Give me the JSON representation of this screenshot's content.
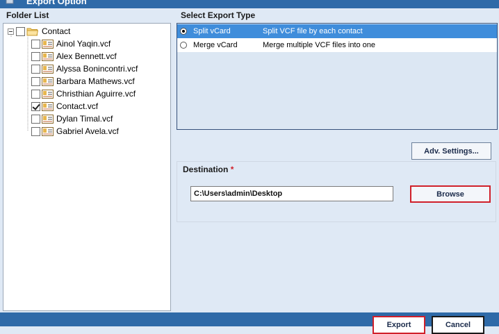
{
  "window": {
    "title": "Export Option"
  },
  "folder_list": {
    "label": "Folder List",
    "root": {
      "label": "Contact",
      "checked": false,
      "expanded": true
    },
    "items": [
      {
        "label": "Ainol Yaqin.vcf",
        "checked": false
      },
      {
        "label": "Alex Bennett.vcf",
        "checked": false
      },
      {
        "label": "Alyssa Bonincontri.vcf",
        "checked": false
      },
      {
        "label": "Barbara Mathews.vcf",
        "checked": false
      },
      {
        "label": "Christhian Aguirre.vcf",
        "checked": false
      },
      {
        "label": "Contact.vcf",
        "checked": true
      },
      {
        "label": "Dylan Timal.vcf",
        "checked": false
      },
      {
        "label": "Gabriel Avela.vcf",
        "checked": false
      }
    ]
  },
  "export_type": {
    "label": "Select Export Type",
    "options": [
      {
        "name": "Split vCard",
        "description": "Split VCF file by each contact",
        "selected": true
      },
      {
        "name": "Merge vCard",
        "description": "Merge multiple VCF files into one",
        "selected": false
      }
    ]
  },
  "adv_settings_label": "Adv. Settings...",
  "destination": {
    "label": "Destination",
    "required_mark": "*",
    "path": "C:\\Users\\admin\\Desktop",
    "browse_label": "Browse"
  },
  "footer": {
    "export_label": "Export",
    "cancel_label": "Cancel"
  },
  "colors": {
    "title_bar": "#2f6aa8",
    "selection": "#3f8ddb",
    "highlight_border": "#d0202a",
    "background": "#dfe9f5"
  }
}
